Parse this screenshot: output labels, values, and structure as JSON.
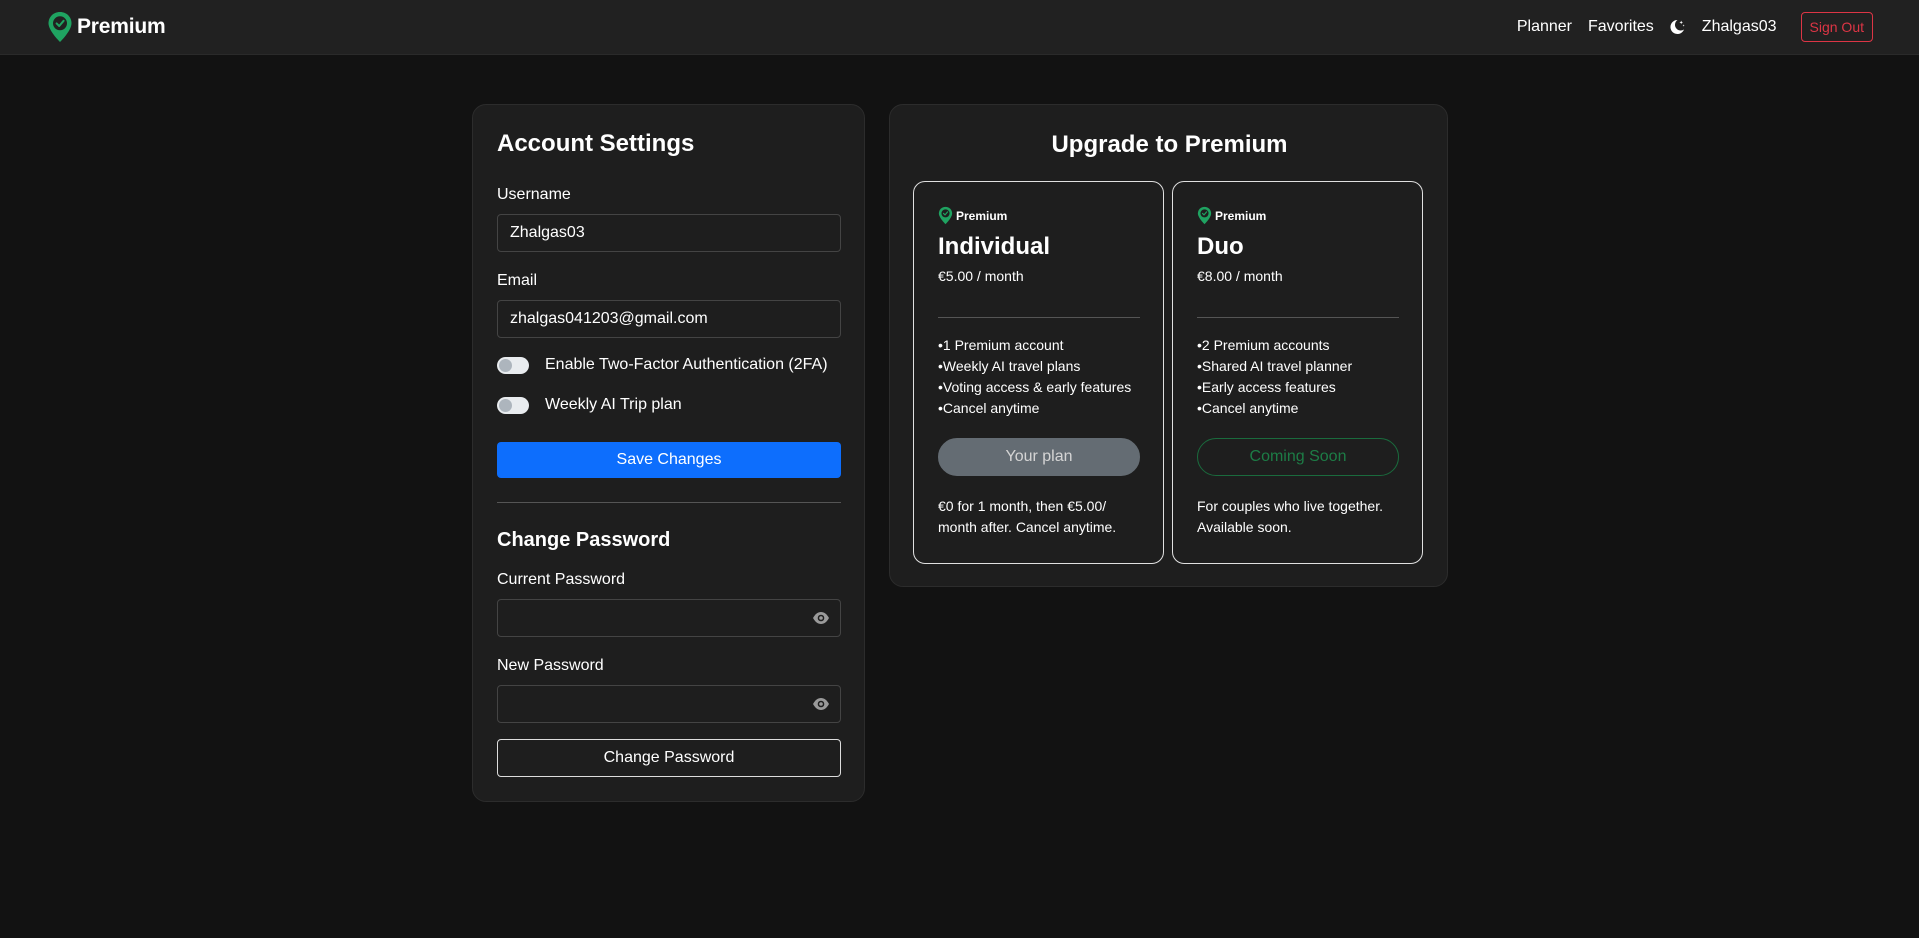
{
  "navbar": {
    "brand": "Premium",
    "links": [
      "Planner",
      "Favorites"
    ],
    "theme_icon": "moon-icon",
    "username": "Zhalgas03",
    "sign_out": "Sign Out"
  },
  "account": {
    "title": "Account Settings",
    "username_label": "Username",
    "username_value": "Zhalgas03",
    "email_label": "Email",
    "email_value": "zhalgas041203@gmail.com",
    "toggle_2fa": "Enable Two-Factor Authentication (2FA)",
    "toggle_weekly": "Weekly AI Trip plan",
    "save_button": "Save Changes",
    "password_title": "Change Password",
    "current_password_label": "Current Password",
    "new_password_label": "New Password",
    "change_password_button": "Change Password"
  },
  "upgrade": {
    "title": "Upgrade to Premium",
    "plans": [
      {
        "brand": "Premium",
        "name": "Individual",
        "price": "€5.00 / month",
        "features": [
          "1 Premium account",
          "Weekly AI travel plans",
          "Voting access & early features",
          "Cancel anytime"
        ],
        "button": "Your plan",
        "note_line1": "€0 for 1 month, then €5.00/",
        "note_line2": "month after. Cancel anytime."
      },
      {
        "brand": "Premium",
        "name": "Duo",
        "price": "€8.00 / month",
        "features": [
          "2 Premium accounts",
          "Shared AI travel planner",
          "Early access features",
          "Cancel anytime"
        ],
        "button": "Coming Soon",
        "note_line1": "For couples who live together.",
        "note_line2": "Available soon."
      }
    ]
  },
  "colors": {
    "background": "#121212",
    "navbar": "#212121",
    "card": "#1e1e1e",
    "primary": "#0d6efd",
    "danger": "#dc3545",
    "brand_green": "#1fa361"
  }
}
